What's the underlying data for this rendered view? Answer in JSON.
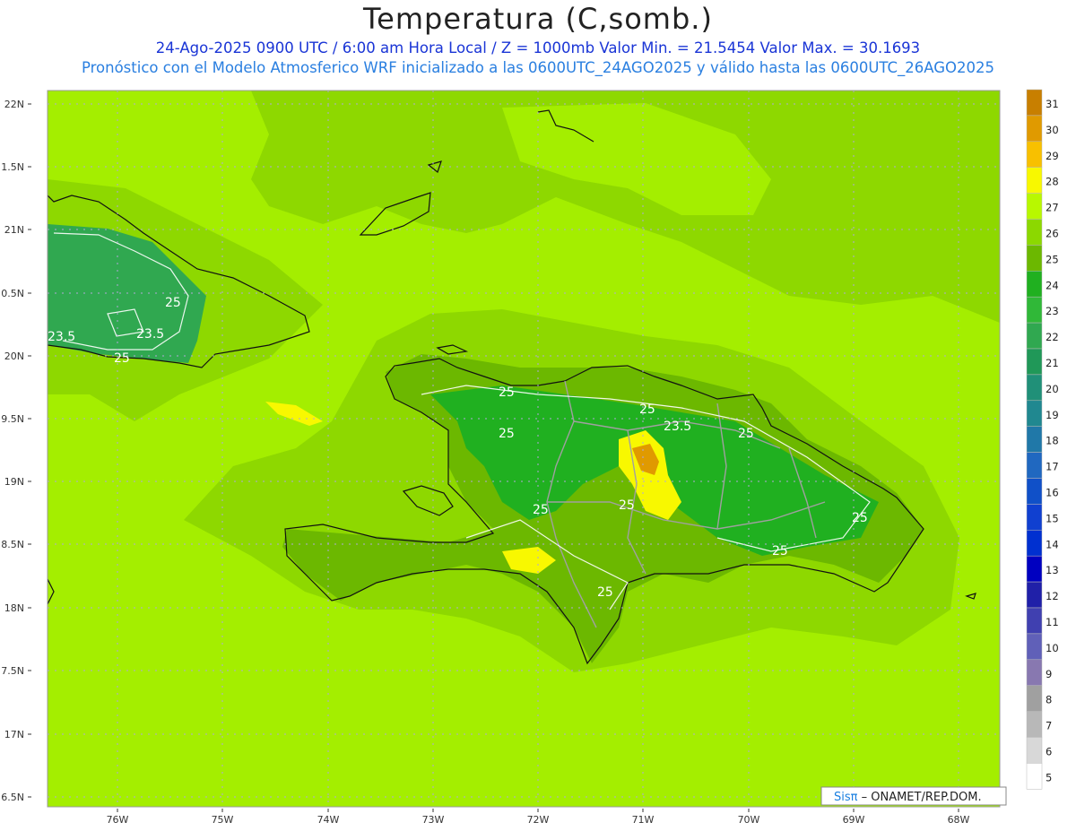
{
  "header": {
    "title": "Temperatura (C,somb.)",
    "line1": "24-Ago-2025  0900 UTC / 6:00 am Hora Local / Z = 1000mb   Valor Min. = 21.5454  Valor Max. = 30.1693",
    "line2": "Pronóstico con el Modelo Atmosferico WRF inicializado a las 0600UTC_24AGO2025 y válido hasta las  0600UTC_26AGO2025"
  },
  "axes": {
    "lat_labels": [
      "22N",
      "1.5N",
      "21N",
      "0.5N",
      "20N",
      "9.5N",
      "19N",
      "8.5N",
      "18N",
      "7.5N",
      "17N",
      "6.5N"
    ],
    "lon_labels": [
      "76W",
      "75W",
      "74W",
      "73W",
      "72W",
      "71W",
      "70W",
      "69W",
      "68W"
    ]
  },
  "contour_labels": [
    "25",
    "23.5",
    "25",
    "23.5",
    "25",
    "25",
    "25",
    "23.5",
    "25",
    "25",
    "25",
    "25",
    "25",
    "25"
  ],
  "colorbar": {
    "labels": [
      "31",
      "30",
      "29",
      "28",
      "27",
      "26",
      "25",
      "24",
      "23",
      "22",
      "21",
      "20",
      "19",
      "18",
      "17",
      "16",
      "15",
      "14",
      "13",
      "12",
      "11",
      "10",
      "9",
      "8",
      "7",
      "6",
      "5"
    ],
    "colors": [
      "#c87f00",
      "#e09a00",
      "#f8c000",
      "#f8f800",
      "#b8f800",
      "#8cd800",
      "#6cb800",
      "#20b020",
      "#30b838",
      "#30a850",
      "#209858",
      "#209078",
      "#208890",
      "#2078a8",
      "#2068c0",
      "#1050c8",
      "#1040d0",
      "#0030d0",
      "#0000c0",
      "#2020a8",
      "#4040b0",
      "#6060b8",
      "#8878b0",
      "#a0a0a0",
      "#b8b8b8",
      "#d8d8d8",
      "#ffffff"
    ]
  },
  "credit": {
    "brand": "Sisπ",
    "text": " – ONAMET/REP.DOM."
  }
}
